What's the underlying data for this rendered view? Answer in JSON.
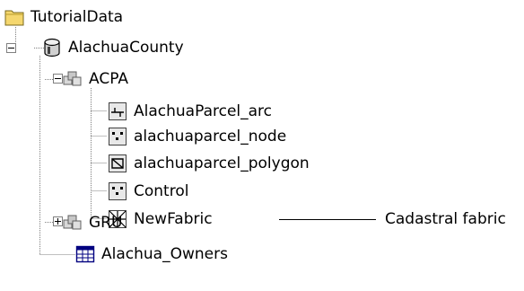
{
  "tree": {
    "root": {
      "label": "TutorialData",
      "icon": "folder-icon",
      "color": "#f5d76e"
    },
    "database": {
      "label": "AlachuaCounty",
      "icon": "geodatabase-icon",
      "expanded": true
    },
    "acpa": {
      "label": "ACPA",
      "icon": "feature-dataset-icon",
      "expanded": true
    },
    "acpa_children": [
      {
        "label": "AlachuaParcel_arc",
        "icon": "line-feature-class-icon"
      },
      {
        "label": "alachuaparcel_node",
        "icon": "point-feature-class-icon"
      },
      {
        "label": "alachuaparcel_polygon",
        "icon": "polygon-feature-class-icon"
      },
      {
        "label": "Control",
        "icon": "point-feature-class-icon"
      },
      {
        "label": "NewFabric",
        "icon": "cadastral-fabric-icon"
      }
    ],
    "gru": {
      "label": "GRU",
      "icon": "feature-dataset-icon",
      "expanded": false
    },
    "owners": {
      "label": "Alachua_Owners",
      "icon": "table-icon"
    }
  },
  "callout": {
    "label": "Cadastral fabric"
  }
}
